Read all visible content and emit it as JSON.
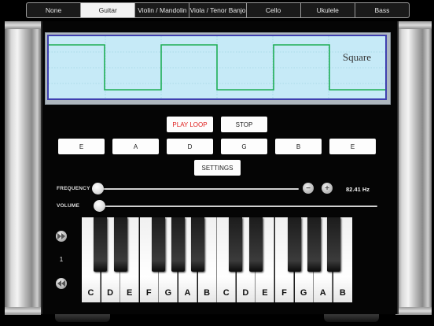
{
  "instruments": {
    "items": [
      "None",
      "Guitar",
      "Violin / Mandolin",
      "Viola / Tenor Banjo",
      "Cello",
      "Ukulele",
      "Bass"
    ],
    "selected": "Guitar"
  },
  "scope": {
    "waveform": "Square",
    "wave_color": "#1fae55",
    "background_color": "#c6eaf7"
  },
  "controls": {
    "play_label": "PLAY LOOP",
    "stop_label": "STOP",
    "settings_label": "SETTINGS",
    "play_color": "#e0201e"
  },
  "strings": [
    "E",
    "A",
    "D",
    "G",
    "B",
    "E"
  ],
  "frequency": {
    "label": "FREQUENCY",
    "value_text": "82.41 Hz",
    "slider_level": 0.0,
    "minus_icon": "minus-icon",
    "plus_icon": "plus-icon"
  },
  "volume": {
    "label": "VOLUME",
    "slider_level": 0.0
  },
  "octave": {
    "value": "1",
    "up_icon": "fast-forward-icon",
    "down_icon": "rewind-icon"
  },
  "keyboard": {
    "white_keys": [
      "C",
      "D",
      "E",
      "F",
      "G",
      "A",
      "B",
      "C",
      "D",
      "E",
      "F",
      "G",
      "A",
      "B"
    ]
  }
}
